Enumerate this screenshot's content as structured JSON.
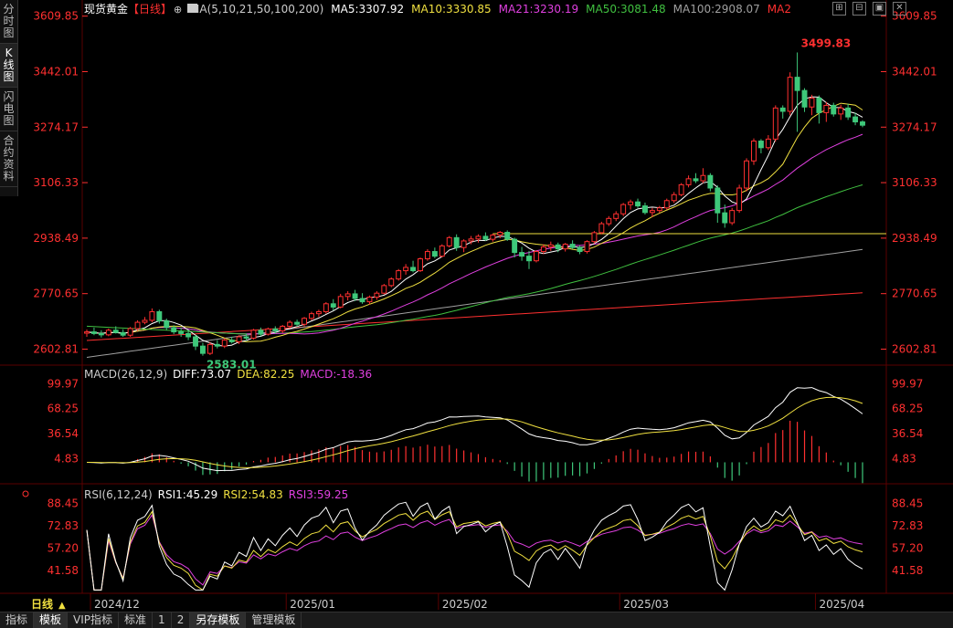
{
  "side_tabs": [
    {
      "label": "分时图"
    },
    {
      "label": "K线图"
    },
    {
      "label": "闪电图"
    },
    {
      "label": "合约资料"
    }
  ],
  "header": {
    "instrument": "现货黄金",
    "period": "【日线】",
    "ma_label": "MA(5,10,21,50,100,200)",
    "ma": [
      {
        "text": "MA5:3307.92",
        "color": "#ffffff"
      },
      {
        "text": "MA10:3330.85",
        "color": "#f0e040"
      },
      {
        "text": "MA21:3230.19",
        "color": "#e040e0"
      },
      {
        "text": "MA50:3081.48",
        "color": "#40c040"
      },
      {
        "text": "MA100:2908.07",
        "color": "#a0a0a0"
      },
      {
        "text": "MA2",
        "color": "#ff3030"
      }
    ]
  },
  "price_axis": [
    "3609.85",
    "3442.01",
    "3274.17",
    "3106.33",
    "2938.49",
    "2770.65",
    "2602.81"
  ],
  "price_annotations": {
    "high": "3499.83",
    "low": "2583.01"
  },
  "macd": {
    "label": "MACD(26,12,9)",
    "diff": "DIFF:73.07",
    "dea": "DEA:82.25",
    "macd": "MACD:-18.36",
    "axis": [
      "99.97",
      "68.25",
      "36.54",
      "4.83"
    ]
  },
  "rsi": {
    "label": "RSI(6,12,24)",
    "rsi1": "RSI1:45.29",
    "rsi2": "RSI2:54.83",
    "rsi3": "RSI3:59.25",
    "axis": [
      "88.45",
      "72.83",
      "57.20",
      "41.58"
    ]
  },
  "period_label": "日线",
  "dates": [
    "2024/12",
    "2025/01",
    "2025/02",
    "2025/03",
    "2025/04"
  ],
  "bottom_tabs": [
    {
      "label": "指标"
    },
    {
      "label": "模板",
      "active": true
    },
    {
      "label": "VIP指标"
    },
    {
      "label": "标准"
    },
    {
      "label": "1"
    },
    {
      "label": "2"
    },
    {
      "label": "另存模板",
      "active": true
    },
    {
      "label": "管理模板"
    }
  ],
  "colors": {
    "up": "#ff3030",
    "down": "#3ec87a",
    "axis": "#ff3030",
    "grid": "#550000"
  },
  "chart_data": {
    "type": "candlestick",
    "ohlc": [
      [
        2651,
        2662,
        2640,
        2655
      ],
      [
        2655,
        2668,
        2645,
        2650
      ],
      [
        2650,
        2660,
        2638,
        2646
      ],
      [
        2646,
        2665,
        2642,
        2660
      ],
      [
        2660,
        2672,
        2650,
        2653
      ],
      [
        2653,
        2663,
        2640,
        2645
      ],
      [
        2645,
        2670,
        2640,
        2665
      ],
      [
        2665,
        2690,
        2658,
        2684
      ],
      [
        2684,
        2700,
        2678,
        2690
      ],
      [
        2690,
        2726,
        2684,
        2716
      ],
      [
        2716,
        2722,
        2680,
        2688
      ],
      [
        2688,
        2695,
        2660,
        2668
      ],
      [
        2668,
        2675,
        2648,
        2655
      ],
      [
        2655,
        2668,
        2640,
        2650
      ],
      [
        2650,
        2662,
        2630,
        2640
      ],
      [
        2640,
        2646,
        2600,
        2612
      ],
      [
        2612,
        2622,
        2583,
        2590
      ],
      [
        2590,
        2624,
        2585,
        2617
      ],
      [
        2617,
        2630,
        2605,
        2612
      ],
      [
        2612,
        2636,
        2606,
        2630
      ],
      [
        2630,
        2640,
        2620,
        2625
      ],
      [
        2625,
        2645,
        2618,
        2640
      ],
      [
        2640,
        2650,
        2628,
        2636
      ],
      [
        2636,
        2664,
        2632,
        2660
      ],
      [
        2660,
        2668,
        2642,
        2648
      ],
      [
        2648,
        2668,
        2644,
        2664
      ],
      [
        2664,
        2672,
        2650,
        2658
      ],
      [
        2658,
        2676,
        2652,
        2672
      ],
      [
        2672,
        2690,
        2665,
        2684
      ],
      [
        2684,
        2692,
        2670,
        2678
      ],
      [
        2678,
        2700,
        2672,
        2696
      ],
      [
        2696,
        2716,
        2690,
        2710
      ],
      [
        2710,
        2722,
        2700,
        2716
      ],
      [
        2716,
        2745,
        2710,
        2740
      ],
      [
        2740,
        2754,
        2720,
        2730
      ],
      [
        2730,
        2770,
        2726,
        2762
      ],
      [
        2762,
        2778,
        2750,
        2770
      ],
      [
        2770,
        2782,
        2748,
        2756
      ],
      [
        2756,
        2772,
        2740,
        2746
      ],
      [
        2746,
        2765,
        2738,
        2760
      ],
      [
        2760,
        2778,
        2752,
        2772
      ],
      [
        2772,
        2800,
        2768,
        2795
      ],
      [
        2795,
        2820,
        2790,
        2815
      ],
      [
        2815,
        2845,
        2810,
        2840
      ],
      [
        2840,
        2860,
        2828,
        2850
      ],
      [
        2850,
        2870,
        2835,
        2840
      ],
      [
        2840,
        2880,
        2836,
        2876
      ],
      [
        2876,
        2905,
        2870,
        2898
      ],
      [
        2898,
        2910,
        2878,
        2884
      ],
      [
        2884,
        2920,
        2880,
        2915
      ],
      [
        2915,
        2945,
        2910,
        2940
      ],
      [
        2940,
        2950,
        2900,
        2910
      ],
      [
        2910,
        2935,
        2896,
        2930
      ],
      [
        2930,
        2945,
        2920,
        2936
      ],
      [
        2936,
        2950,
        2925,
        2944
      ],
      [
        2944,
        2956,
        2930,
        2935
      ],
      [
        2935,
        2952,
        2928,
        2948
      ],
      [
        2948,
        2960,
        2938,
        2956
      ],
      [
        2956,
        2962,
        2930,
        2935
      ],
      [
        2935,
        2940,
        2880,
        2895
      ],
      [
        2895,
        2912,
        2870,
        2884
      ],
      [
        2884,
        2900,
        2845,
        2870
      ],
      [
        2870,
        2902,
        2865,
        2898
      ],
      [
        2898,
        2920,
        2890,
        2912
      ],
      [
        2912,
        2928,
        2900,
        2918
      ],
      [
        2918,
        2925,
        2896,
        2906
      ],
      [
        2906,
        2924,
        2898,
        2920
      ],
      [
        2920,
        2932,
        2905,
        2910
      ],
      [
        2910,
        2916,
        2890,
        2898
      ],
      [
        2898,
        2932,
        2892,
        2928
      ],
      [
        2928,
        2960,
        2922,
        2955
      ],
      [
        2955,
        2988,
        2950,
        2982
      ],
      [
        2982,
        3005,
        2975,
        2998
      ],
      [
        2998,
        3020,
        2990,
        3012
      ],
      [
        3012,
        3045,
        3005,
        3040
      ],
      [
        3040,
        3055,
        3025,
        3048
      ],
      [
        3048,
        3058,
        3030,
        3036
      ],
      [
        3036,
        3046,
        3010,
        3016
      ],
      [
        3016,
        3030,
        3002,
        3022
      ],
      [
        3022,
        3036,
        3015,
        3030
      ],
      [
        3030,
        3058,
        3025,
        3052
      ],
      [
        3052,
        3078,
        3045,
        3070
      ],
      [
        3070,
        3105,
        3065,
        3100
      ],
      [
        3100,
        3128,
        3092,
        3118
      ],
      [
        3118,
        3135,
        3105,
        3112
      ],
      [
        3112,
        3150,
        3105,
        3128
      ],
      [
        3128,
        3135,
        3080,
        3090
      ],
      [
        3090,
        3098,
        2985,
        3015
      ],
      [
        3015,
        3040,
        2970,
        2985
      ],
      [
        2985,
        3030,
        2978,
        3022
      ],
      [
        3022,
        3100,
        3015,
        3090
      ],
      [
        3090,
        3180,
        3080,
        3172
      ],
      [
        3172,
        3240,
        3160,
        3232
      ],
      [
        3232,
        3238,
        3195,
        3212
      ],
      [
        3212,
        3250,
        3205,
        3238
      ],
      [
        3238,
        3340,
        3230,
        3332
      ],
      [
        3332,
        3340,
        3300,
        3322
      ],
      [
        3322,
        3440,
        3310,
        3425
      ],
      [
        3425,
        3500,
        3260,
        3385
      ],
      [
        3385,
        3392,
        3320,
        3335
      ],
      [
        3335,
        3372,
        3310,
        3362
      ],
      [
        3362,
        3370,
        3285,
        3318
      ],
      [
        3318,
        3350,
        3290,
        3340
      ],
      [
        3340,
        3348,
        3306,
        3314
      ],
      [
        3314,
        3342,
        3296,
        3332
      ],
      [
        3332,
        3345,
        3296,
        3305
      ],
      [
        3305,
        3318,
        3280,
        3290
      ],
      [
        3290,
        3295,
        3274,
        3280
      ]
    ],
    "hline": 2952,
    "price_range": [
      2560,
      3620
    ],
    "macd_range": [
      -25,
      105
    ],
    "rsi_range": [
      27,
      92
    ]
  }
}
